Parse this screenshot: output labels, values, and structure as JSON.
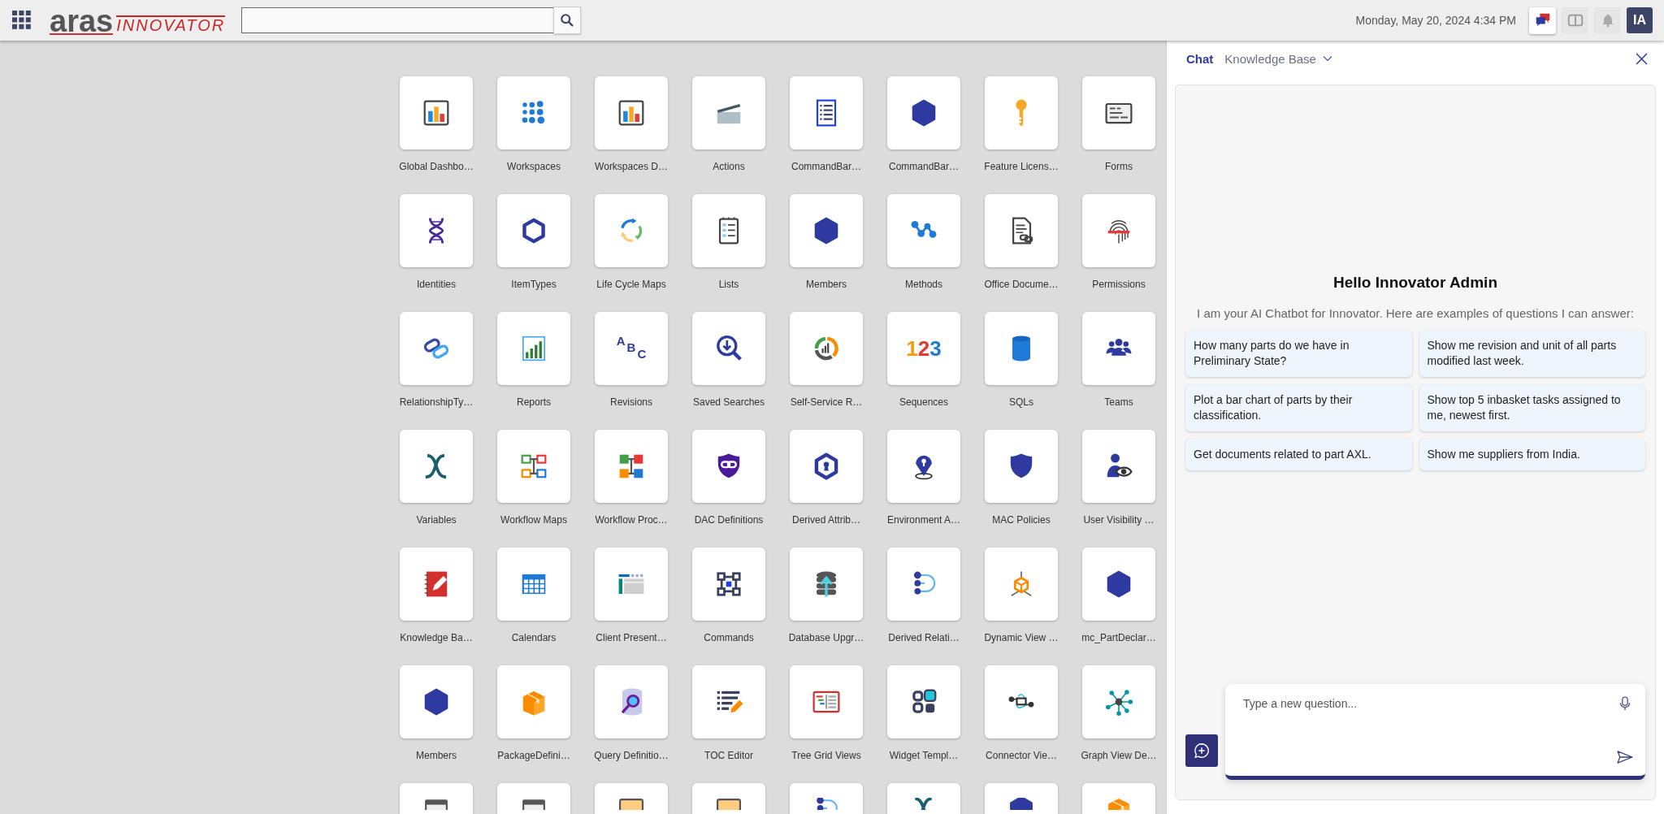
{
  "header": {
    "logo": {
      "word": "aras",
      "sub": "INNOVATOR"
    },
    "datetime": "Monday, May 20, 2024 4:34 PM",
    "tools": [
      {
        "kind": "chat",
        "selected": true
      },
      {
        "kind": "split",
        "selected": false
      },
      {
        "kind": "bell",
        "selected": false
      }
    ],
    "avatar": "IA"
  },
  "tiles": [
    {
      "kind": "app",
      "label": "Global Dashbo…"
    },
    {
      "kind": "app",
      "label": "Workspaces"
    },
    {
      "kind": "app",
      "label": "Workspaces D…"
    },
    {
      "kind": "app",
      "label": "Actions"
    },
    {
      "kind": "app",
      "label": "CommandBar…"
    },
    {
      "kind": "app",
      "label": "CommandBar…"
    },
    {
      "kind": "app",
      "label": "Feature Licens…"
    },
    {
      "kind": "app",
      "label": "Forms"
    },
    {
      "kind": "app",
      "label": "Identities"
    },
    {
      "kind": "app",
      "label": "ItemTypes"
    },
    {
      "kind": "app",
      "label": "Life Cycle Maps"
    },
    {
      "kind": "app",
      "label": "Lists"
    },
    {
      "kind": "app",
      "label": "Members"
    },
    {
      "kind": "app",
      "label": "Methods"
    },
    {
      "kind": "app",
      "label": "Office Docume…"
    },
    {
      "kind": "app",
      "label": "Permissions"
    },
    {
      "kind": "app",
      "label": "RelationshipTy…"
    },
    {
      "kind": "app",
      "label": "Reports"
    },
    {
      "kind": "app",
      "label": "Revisions",
      "icon_text": "ABC"
    },
    {
      "kind": "app",
      "label": "Saved Searches"
    },
    {
      "kind": "app",
      "label": "Self-Service R…"
    },
    {
      "kind": "app",
      "label": "Sequences",
      "icon_text": "123"
    },
    {
      "kind": "app",
      "label": "SQLs"
    },
    {
      "kind": "app",
      "label": "Teams"
    },
    {
      "kind": "app",
      "label": "Variables"
    },
    {
      "kind": "app",
      "label": "Workflow Maps"
    },
    {
      "kind": "app",
      "label": "Workflow Proc…"
    },
    {
      "kind": "app",
      "label": "DAC Definitions"
    },
    {
      "kind": "app",
      "label": "Derived Attrib…"
    },
    {
      "kind": "app",
      "label": "Environment A…"
    },
    {
      "kind": "app",
      "label": "MAC Policies"
    },
    {
      "kind": "app",
      "label": "User Visibility …"
    },
    {
      "kind": "app",
      "label": "Knowledge Ba…"
    },
    {
      "kind": "app",
      "label": "Calendars"
    },
    {
      "kind": "app",
      "label": "Client Present…"
    },
    {
      "kind": "app",
      "label": "Commands"
    },
    {
      "kind": "app",
      "label": "Database Upgr…"
    },
    {
      "kind": "app",
      "label": "Derived Relati…"
    },
    {
      "kind": "app",
      "label": "Dynamic View …"
    },
    {
      "kind": "app",
      "label": "mc_PartDeclar…"
    },
    {
      "kind": "app",
      "label": "Members"
    },
    {
      "kind": "app",
      "label": "PackageDefini…"
    },
    {
      "kind": "app",
      "label": "Query Definitio…"
    },
    {
      "kind": "app",
      "label": "TOC Editor"
    },
    {
      "kind": "app",
      "label": "Tree Grid Views"
    },
    {
      "kind": "app",
      "label": "Widget Templ…"
    },
    {
      "kind": "app",
      "label": "Connector Vie…"
    },
    {
      "kind": "app",
      "label": "Graph View De…"
    },
    {
      "kind": "cut"
    },
    {
      "kind": "cut"
    },
    {
      "kind": "cut"
    },
    {
      "kind": "cut"
    },
    {
      "kind": "cut"
    },
    {
      "kind": "cut"
    },
    {
      "kind": "cut"
    },
    {
      "kind": "cut"
    }
  ],
  "chat": {
    "tabs": [
      {
        "label": "Chat",
        "selected": true,
        "menu": false
      },
      {
        "label": "Knowledge Base",
        "selected": false,
        "menu": true
      }
    ],
    "greeting": "Hello Innovator Admin",
    "intro": "I am your AI Chatbot for Innovator. Here are examples of questions I can answer:",
    "suggestions": [
      "How many parts do we have in Preliminary State?",
      "Show me revision and unit of all parts modified last week.",
      "Plot a bar chart of parts by their classification.",
      "Show top 5 inbasket tasks assigned to me, newest first.",
      "Get documents related to part AXL.",
      "Show me suppliers from India."
    ],
    "input": {
      "placeholder": "Type a new question..."
    }
  }
}
